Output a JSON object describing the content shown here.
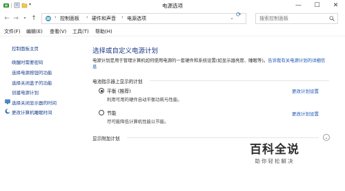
{
  "window": {
    "title": "电源选项",
    "buttons": {
      "minimize": "—",
      "maximize": "☐",
      "close": "✕"
    }
  },
  "address": {
    "breadcrumbs": [
      "控制面板",
      "硬件和声音",
      "电源选项"
    ],
    "search_placeholder": "搜索控制面板"
  },
  "menubar": {
    "items": [
      "文件(F)",
      "编辑(E)",
      "查看(V)",
      "工具(T)",
      "帮助(H)"
    ]
  },
  "sidebar": {
    "home": "控制面板主页",
    "links": [
      "唤醒时需要密码",
      "选择电源按钮的功能",
      "选择关闭盖子的功能",
      "创建电源计划"
    ],
    "icon_links": [
      "选择关闭显示器的时间",
      "更改计算机睡眠时间"
    ]
  },
  "main": {
    "heading": "选择或自定义电源计划",
    "description": "电源计划是用于管理计算机如何使用电源的一套硬件和系统设置(如显示器亮度、睡眠等)。",
    "description_link": "告诉我有关电源计划的详细信息",
    "section_title": "电池指示器上显示的计划",
    "plans": [
      {
        "name": "平衡 (推荐)",
        "desc": "利用可用的硬件自动平衡功耗与性能。",
        "link": "更改计划设置",
        "checked": true
      },
      {
        "name": "节能",
        "desc": "尽可能降低计算机性能以节能。",
        "link": "更改计划设置",
        "checked": false
      }
    ],
    "additional_title": "显示附加计划"
  },
  "watermark": {
    "title": "百科全说",
    "subtitle": "助你轻松解决"
  }
}
